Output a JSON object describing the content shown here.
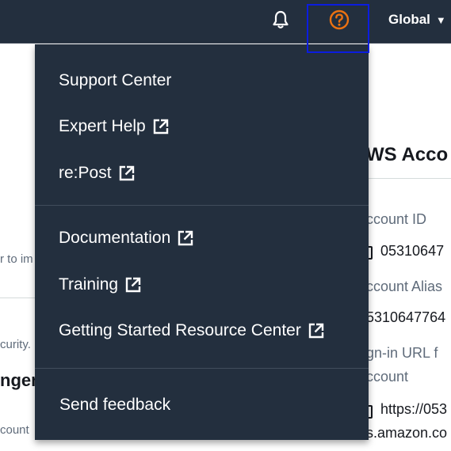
{
  "topbar": {
    "region_label": "Global",
    "icons": [
      "bell-icon",
      "help-icon",
      "caret-down-icon"
    ]
  },
  "help_menu": {
    "groups": [
      [
        {
          "label": "Support Center",
          "external": false
        },
        {
          "label": "Expert Help",
          "external": true
        },
        {
          "label": "re:Post",
          "external": true
        }
      ],
      [
        {
          "label": "Documentation",
          "external": true
        },
        {
          "label": "Training",
          "external": true
        },
        {
          "label": "Getting Started Resource Center",
          "external": true
        }
      ],
      [
        {
          "label": "Send feedback",
          "external": false
        }
      ]
    ]
  },
  "background": {
    "account_heading": "WS Acco",
    "account_id_label": "ccount ID",
    "account_id_value": "05310647",
    "account_alias_label": "ccount Alias",
    "account_alias_value": "5310647764",
    "signin_label_1": "gn-in URL f",
    "signin_label_2": "ccount",
    "signin_value_1": "https://053",
    "signin_value_2": "s.amazon.co",
    "left_frag_1": "r to im",
    "left_frag_2": "curity.",
    "left_heading": "ngem",
    "left_frag_3": "count"
  },
  "colors": {
    "topbar_bg": "#232f3e",
    "menu_bg": "#232f3e",
    "help_accent": "#ec7211",
    "highlight_box": "#0b1de0"
  }
}
